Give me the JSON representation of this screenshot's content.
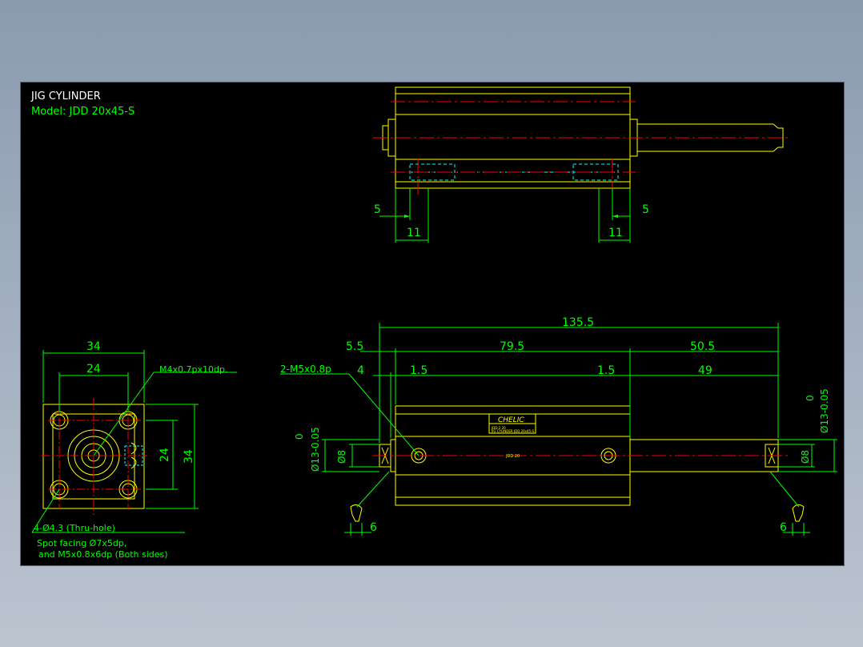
{
  "title_block": {
    "title": "JIG CYLINDER",
    "model": "Model: JDD 20x45-S"
  },
  "top_view": {
    "dims": {
      "left_offset": "5",
      "right_offset": "5",
      "left_width": "11",
      "right_width": "11"
    }
  },
  "end_view": {
    "dims": {
      "width_outer": "34",
      "width_inner": "24",
      "height_inner": "24",
      "height_outer": "34"
    },
    "callouts": {
      "thread": "M4x0.7px10dp.",
      "holes": "4-Ø4.3 (Thru-hole)",
      "spot_line1": "Spot facing Ø7x5dp,",
      "spot_line2": "and M5x0.8x6dp (Both sides)"
    }
  },
  "side_view": {
    "dims": {
      "total_length": "135.5",
      "left_end": "5.5",
      "body_length": "79.5",
      "rod_length": "50.5",
      "step_left": "4",
      "step_left2": "1.5",
      "step_right": "1.5",
      "rod_ext": "49",
      "wrench_left": "6",
      "wrench_right": "6"
    },
    "callouts": {
      "ports": "2-M5x0.8p",
      "left_tol_upper": "0",
      "left_tol_lower": "Ø13-0.05",
      "right_tol_upper": "0",
      "right_tol_lower": "Ø13-0.05",
      "left_dia": "Ø8",
      "right_dia": "Ø8"
    },
    "label": {
      "brand": "CHELIC",
      "line1": "JDD-2 20",
      "line2": "JIG CYLINDER JDD 20x45-S",
      "center": "JDD 20"
    }
  },
  "colors": {
    "outline": "#ffff00",
    "dimension": "#00ff00",
    "centerline": "#ff0000",
    "hidden": "#00ffff",
    "text": "#ffffff",
    "background": "#000000"
  }
}
